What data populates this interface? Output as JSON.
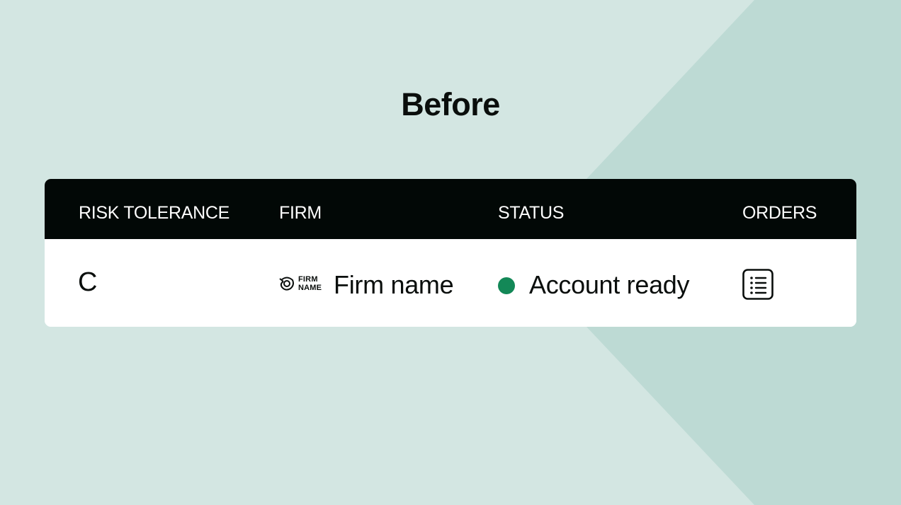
{
  "page": {
    "title": "Before",
    "background_color": "#d3e6e2",
    "accent_shape_color": "#bddad4"
  },
  "table": {
    "header_bg": "#020806",
    "columns": [
      "RISK TOLERANCE",
      "FIRM",
      "STATUS",
      "ORDERS"
    ],
    "rows": [
      {
        "risk_tolerance": "C",
        "firm": {
          "logo_icon": "firm-logo-icon",
          "logo_text_line1": "FIRM",
          "logo_text_line2": "NAME",
          "name": "Firm name"
        },
        "status": {
          "label": "Account ready",
          "color": "#138857"
        },
        "orders_icon": "list-icon"
      }
    ]
  }
}
